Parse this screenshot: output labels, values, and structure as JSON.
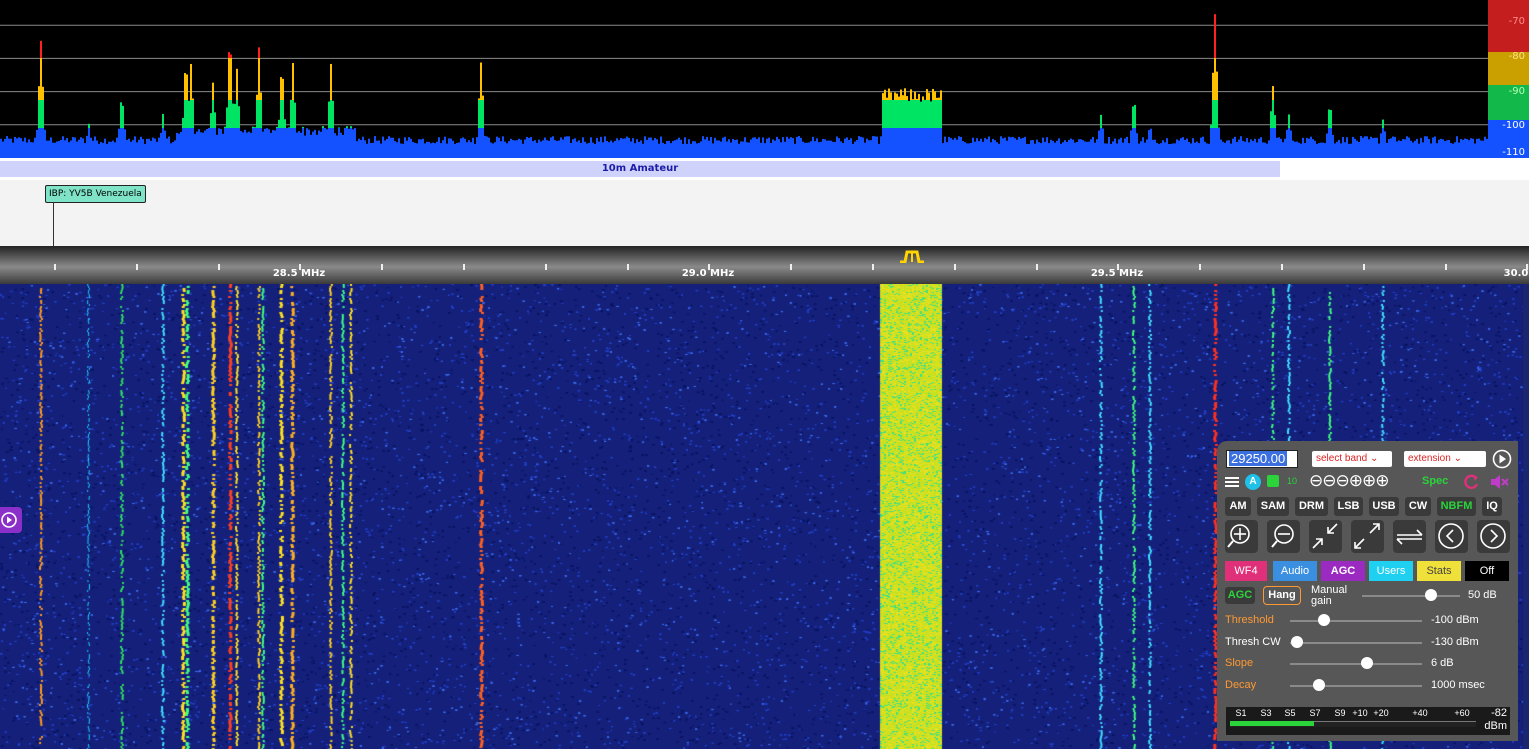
{
  "spectrum": {
    "db_labels": [
      "-70",
      "-80",
      "-90",
      "-100",
      "-110"
    ],
    "colors": {
      "noise": "#1451ff",
      "green": "#00e464",
      "yellow": "#ffc000",
      "red": "#ff2020"
    }
  },
  "band": {
    "label": "10m Amateur"
  },
  "ibp_label": "IBP: YV5B Venezuela",
  "freq_scale": {
    "labels": [
      "28.5 MHz",
      "29.0 MHz",
      "29.5 MHz",
      "30.0"
    ]
  },
  "panel": {
    "frequency": "29250.00",
    "select_band": "select band",
    "extension": "extension",
    "top_row": {
      "a_badge": "A",
      "ten": "10",
      "zoom_icons": "⊖⊖⊖⊕⊕⊕",
      "spec": "Spec"
    },
    "modes": [
      "AM",
      "SAM",
      "DRM",
      "LSB",
      "USB",
      "CW",
      "NBFM",
      "IQ"
    ],
    "tabs": [
      "WF4",
      "Audio",
      "AGC",
      "Users",
      "Stats",
      "Off"
    ],
    "agc": {
      "agc_label": "AGC",
      "hang_label": "Hang",
      "manual_gain_label": "Manual gain",
      "manual_gain_value": "50 dB",
      "manual_gain_level": 0.7
    },
    "sliders": [
      {
        "label": "Threshold",
        "value": "-100 dBm",
        "level": 0.26,
        "color": "#ff9933"
      },
      {
        "label": "Thresh CW",
        "value": "-130 dBm",
        "level": 0.05,
        "color": "#ffffff"
      },
      {
        "label": "Slope",
        "value": "6 dB",
        "level": 0.58,
        "color": "#ff9933"
      },
      {
        "label": "Decay",
        "value": "1000 msec",
        "level": 0.22,
        "color": "#ff9933"
      }
    ],
    "smeter": {
      "labels": [
        "S1",
        "S3",
        "S5",
        "S7",
        "S9",
        "+10",
        "+20",
        "+40",
        "+60"
      ],
      "reading": "-82",
      "unit": "dBm",
      "level": 0.34
    }
  }
}
